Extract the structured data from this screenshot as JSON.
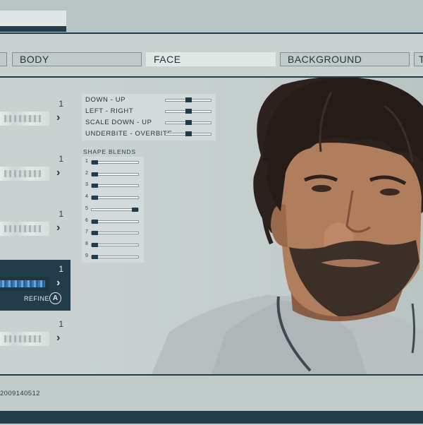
{
  "tabs": [
    {
      "label": "BODY"
    },
    {
      "label": "FACE"
    },
    {
      "label": "BACKGROUND"
    },
    {
      "label": "T"
    }
  ],
  "active_tab": "FACE",
  "slots": [
    {
      "count": "1"
    },
    {
      "count": "1"
    },
    {
      "count": "1"
    },
    {
      "count": "1",
      "refine_label": "REFINE",
      "refine_button": "A"
    },
    {
      "count": "1"
    }
  ],
  "adjustments": [
    {
      "label": "DOWN - UP",
      "value": 0.5
    },
    {
      "label": "LEFT - RIGHT",
      "value": 0.5
    },
    {
      "label": "SCALE DOWN - UP",
      "value": 0.5
    },
    {
      "label": "UNDERBITE - OVERBITE",
      "value": 0.5
    }
  ],
  "shape_blends": {
    "label": "SHAPE BLENDS",
    "rows": [
      {
        "num": "1",
        "value": 0.0
      },
      {
        "num": "2",
        "value": 0.0
      },
      {
        "num": "3",
        "value": 0.0
      },
      {
        "num": "4",
        "value": 0.0
      },
      {
        "num": "5",
        "value": 1.0
      },
      {
        "num": "6",
        "value": 0.0
      },
      {
        "num": "7",
        "value": 0.0
      },
      {
        "num": "8",
        "value": 0.0
      },
      {
        "num": "9",
        "value": 0.0
      }
    ]
  },
  "footer": {
    "seed": "2009140512"
  },
  "icons": {
    "arrow": "chevron-right-icon",
    "button": "controller-a-button-icon"
  },
  "colors": {
    "accent": "#233c4a",
    "tab_active": "#e2e8e6",
    "background": "#c9d2d1"
  }
}
